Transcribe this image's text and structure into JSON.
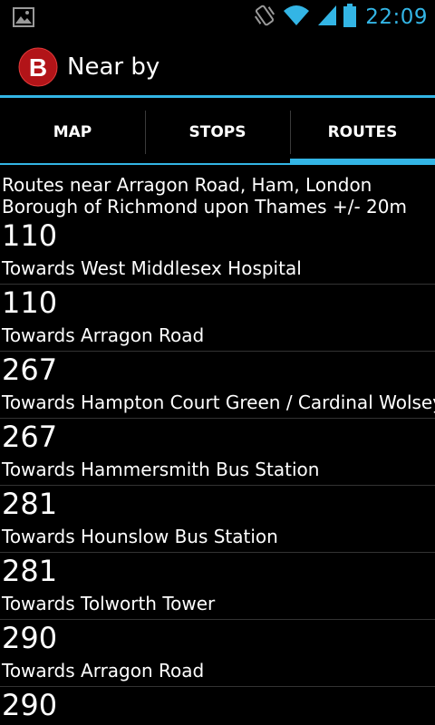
{
  "status_bar": {
    "time": "22:09",
    "icons": [
      "image-notification-icon",
      "vibrate-icon",
      "wifi-icon",
      "signal-icon",
      "battery-icon"
    ],
    "accent_color": "#33b5e5"
  },
  "action_bar": {
    "logo_letter": "B",
    "title": "Near by"
  },
  "tabs": [
    {
      "label": "MAP",
      "active": false
    },
    {
      "label": "STOPS",
      "active": false
    },
    {
      "label": "ROUTES",
      "active": true
    }
  ],
  "content": {
    "intro": "Routes near Arragon Road, Ham, London Borough of Richmond upon Thames +/- 20m",
    "routes": [
      {
        "number": "110",
        "destination": "Towards West Middlesex Hospital"
      },
      {
        "number": "110",
        "destination": "Towards Arragon Road"
      },
      {
        "number": "267",
        "destination": "Towards Hampton Court Green / Cardinal Wolsey"
      },
      {
        "number": "267",
        "destination": "Towards Hammersmith Bus Station"
      },
      {
        "number": "281",
        "destination": "Towards Hounslow Bus Station"
      },
      {
        "number": "281",
        "destination": "Towards Tolworth Tower"
      },
      {
        "number": "290",
        "destination": "Towards Arragon Road"
      },
      {
        "number": "290",
        "destination": ""
      }
    ]
  }
}
